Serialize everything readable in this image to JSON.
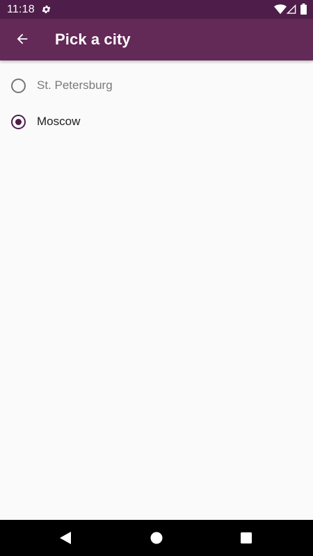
{
  "status_bar": {
    "time": "11:18",
    "icons": [
      "gear-icon",
      "wifi-icon",
      "signal-icon",
      "battery-icon"
    ],
    "background": "#4e1d49"
  },
  "app_bar": {
    "title": "Pick a city",
    "back_icon": "arrow-back-icon",
    "background": "#632957"
  },
  "cities": [
    {
      "label": "St. Petersburg",
      "selected": false
    },
    {
      "label": "Moscow",
      "selected": true
    }
  ],
  "nav_bar": {
    "icons": [
      "back-triangle-icon",
      "home-circle-icon",
      "recents-square-icon"
    ]
  },
  "colors": {
    "accent": "#4e1d49",
    "background": "#fafafa",
    "unchecked_text": "#7a7a7a",
    "checked_text": "#212121"
  }
}
